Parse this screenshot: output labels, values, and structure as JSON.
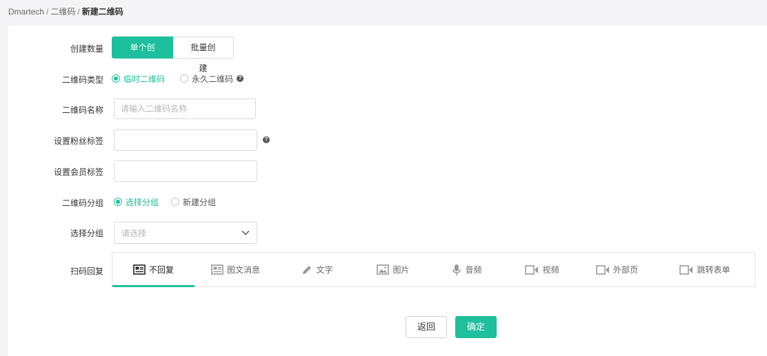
{
  "breadcrumb": {
    "items": [
      "Dmartech",
      "二维码"
    ],
    "separator": "/",
    "current": "新建二维码"
  },
  "form": {
    "create_count": {
      "label": "创建数量",
      "options": [
        "单个创建",
        "批量创建"
      ],
      "selected": "单个创建"
    },
    "qr_type": {
      "label": "二维码类型",
      "options": [
        "临时二维码",
        "永久二维码"
      ],
      "selected": "临时二维码"
    },
    "qr_name": {
      "label": "二维码名称",
      "placeholder": "请输入二维码名称",
      "value": ""
    },
    "fan_tag": {
      "label": "设置粉丝标签",
      "value": ""
    },
    "member_tag": {
      "label": "设置会员标签",
      "value": ""
    },
    "qr_group": {
      "label": "二维码分组",
      "options": [
        "选择分组",
        "新建分组"
      ],
      "selected": "选择分组"
    },
    "select_group": {
      "label": "选择分组",
      "placeholder": "请选择"
    },
    "scan_reply": {
      "label": "扫码回复",
      "tabs": [
        {
          "label": "不回复",
          "icon": "no-reply-icon"
        },
        {
          "label": "图文消息",
          "icon": "news-icon"
        },
        {
          "label": "文字",
          "icon": "pencil-icon"
        },
        {
          "label": "图片",
          "icon": "image-icon"
        },
        {
          "label": "音频",
          "icon": "microphone-icon"
        },
        {
          "label": "视频",
          "icon": "video-icon"
        },
        {
          "label": "外部页",
          "icon": "video-icon"
        },
        {
          "label": "跳转表单",
          "icon": "video-icon"
        }
      ],
      "active": "不回复"
    }
  },
  "actions": {
    "back": "返回",
    "confirm": "确定"
  },
  "colors": {
    "accent": "#1dbf9c"
  },
  "help_icon": "?"
}
